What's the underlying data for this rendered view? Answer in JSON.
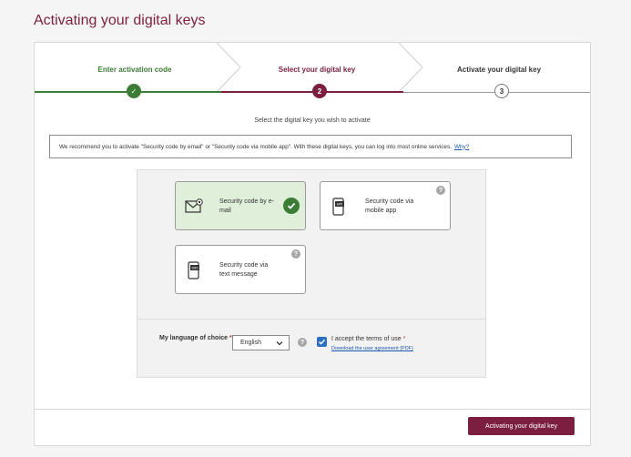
{
  "page": {
    "title": "Activating your digital keys"
  },
  "stepper": {
    "steps": [
      {
        "label": "Enter activation code",
        "state": "completed",
        "marker": "✓"
      },
      {
        "label": "Select your digital key",
        "state": "active",
        "marker": "2"
      },
      {
        "label": "Activate your digital key",
        "state": "pending",
        "marker": "3"
      }
    ]
  },
  "instruction": "Select the digital key you wish to activate",
  "recommendation": {
    "text": "We recommend you to activate \"Security code by email\" or \"Security code via mobile app\". With these digital keys, you can log into most online services.",
    "link": "Why?"
  },
  "options": [
    {
      "label": "Security code by e-mail",
      "icon": "envelope-icon",
      "selected": true
    },
    {
      "label": "Security code via mobile app",
      "icon": "mobile-app-icon",
      "selected": false,
      "help": "?"
    },
    {
      "label": "Security code via text message",
      "icon": "sms-phone-icon",
      "selected": false,
      "help": "?"
    }
  ],
  "language": {
    "label": "My language of choice",
    "required_mark": "*",
    "value": "English",
    "help": "?"
  },
  "terms": {
    "label": "I accept the terms of use",
    "required_mark": "*",
    "checked": true,
    "link": "Download the user agreement (PDF)"
  },
  "submit": {
    "label": "Activating your digital key"
  },
  "colors": {
    "brand": "#7b1e3f",
    "success": "#3c7d36",
    "link": "#1a56b0",
    "checkbox": "#2f6fc0"
  }
}
